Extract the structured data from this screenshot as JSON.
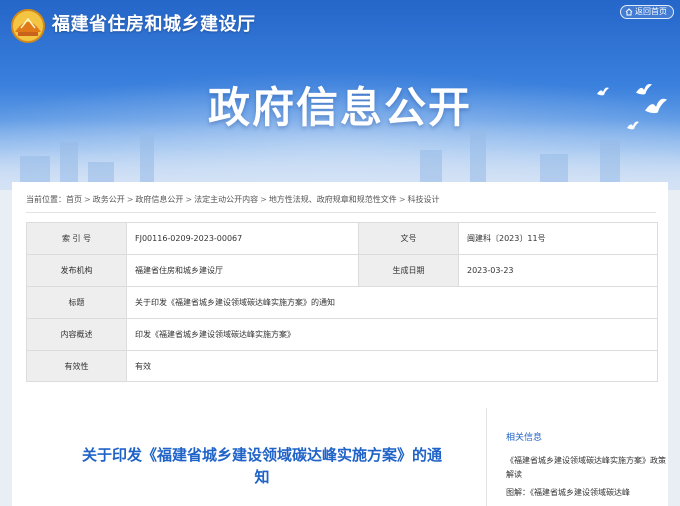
{
  "header": {
    "site_title": "福建省住房和城乡建设厅",
    "back_home": "返回首页",
    "hero_title": "政府信息公开"
  },
  "breadcrumb": {
    "label": "当前位置：",
    "items": [
      "首页",
      "政务公开",
      "政府信息公开",
      "法定主动公开内容",
      "地方性法规、政府规章和规范性文件",
      "科技设计"
    ]
  },
  "meta": {
    "index_label": "索 引 号",
    "index_value": "FJ00116-0209-2023-00067",
    "docno_label": "文号",
    "docno_value": "闽建科〔2023〕11号",
    "issuer_label": "发布机构",
    "issuer_value": "福建省住房和城乡建设厅",
    "date_label": "生成日期",
    "date_value": "2023-03-23",
    "title_label": "标题",
    "title_value": "关于印发《福建省城乡建设领域碳达峰实施方案》的通知",
    "summary_label": "内容概述",
    "summary_value": "印发《福建省城乡建设领域碳达峰实施方案》",
    "validity_label": "有效性",
    "validity_value": "有效"
  },
  "document": {
    "title": "关于印发《福建省城乡建设领域碳达峰实施方案》的通知"
  },
  "related": {
    "heading": "相关信息",
    "items": [
      "《福建省城乡建设领域碳达峰实施方案》政策解读",
      "图解：《福建省城乡建设领域碳达峰"
    ]
  },
  "colors": {
    "banner_blue": "#2566c9",
    "link_blue": "#1f63c8",
    "label_bg": "#eeeeee"
  },
  "icons": {
    "logo": "emblem-logo",
    "back_home": "home-icon",
    "decoration": "dove-icon"
  }
}
